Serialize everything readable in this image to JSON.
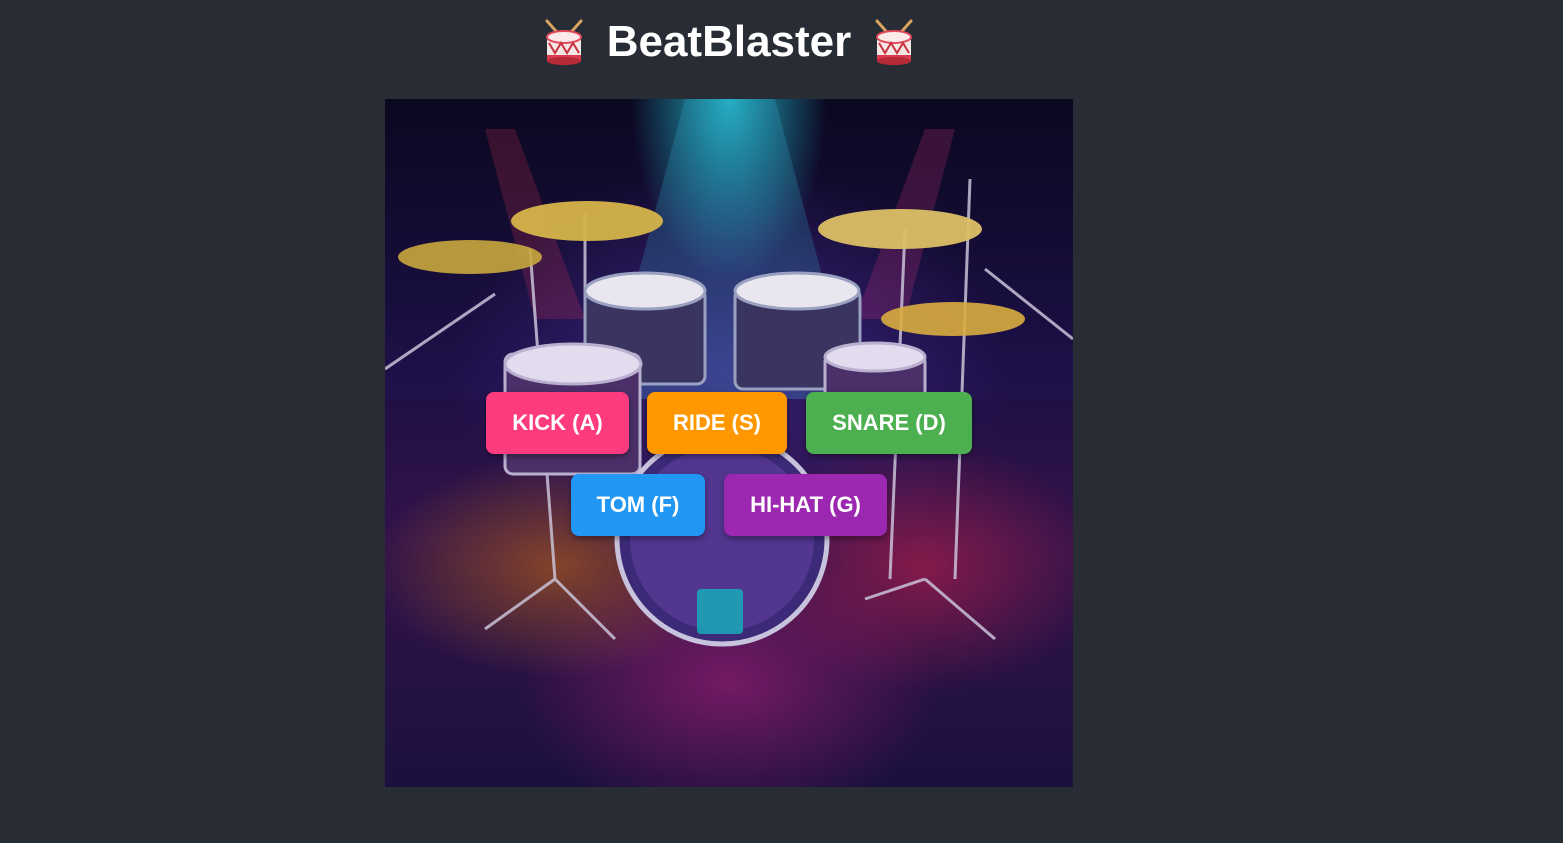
{
  "header": {
    "title": "BeatBlaster",
    "left_icon": "drum-icon",
    "right_icon": "drum-icon"
  },
  "stage": {
    "image": "drum-kit-stage-image"
  },
  "pads": [
    {
      "id": "kick",
      "label": "KICK (A)",
      "color": "#ff3b7f"
    },
    {
      "id": "ride",
      "label": "RIDE (S)",
      "color": "#ff9800"
    },
    {
      "id": "snare",
      "label": "SNARE (D)",
      "color": "#4caf50"
    },
    {
      "id": "tom",
      "label": "TOM (F)",
      "color": "#2196f3"
    },
    {
      "id": "hihat",
      "label": "HI-HAT (G)",
      "color": "#9c27b0"
    }
  ],
  "colors": {
    "background": "#282c34",
    "title": "#ffffff"
  }
}
